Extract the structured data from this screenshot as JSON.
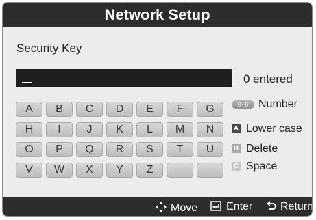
{
  "title": "Network Setup",
  "section_label": "Security Key",
  "entered_text": "0 entered",
  "keyboard": {
    "rows": [
      [
        "A",
        "B",
        "C",
        "D",
        "E",
        "F",
        "G"
      ],
      [
        "H",
        "I",
        "J",
        "K",
        "L",
        "M",
        "N"
      ],
      [
        "O",
        "P",
        "Q",
        "R",
        "S",
        "T",
        "U"
      ],
      [
        "V",
        "W",
        "X",
        "Y",
        "Z",
        "",
        ""
      ]
    ]
  },
  "legend": {
    "number": {
      "badge": "0~9",
      "label": "Number"
    },
    "a": {
      "badge": "A",
      "label": "Lower case"
    },
    "b": {
      "badge": "B",
      "label": "Delete"
    },
    "c": {
      "badge": "C",
      "label": "Space"
    }
  },
  "bottom_bar": {
    "move": "Move",
    "enter": "Enter",
    "return": "Return"
  }
}
